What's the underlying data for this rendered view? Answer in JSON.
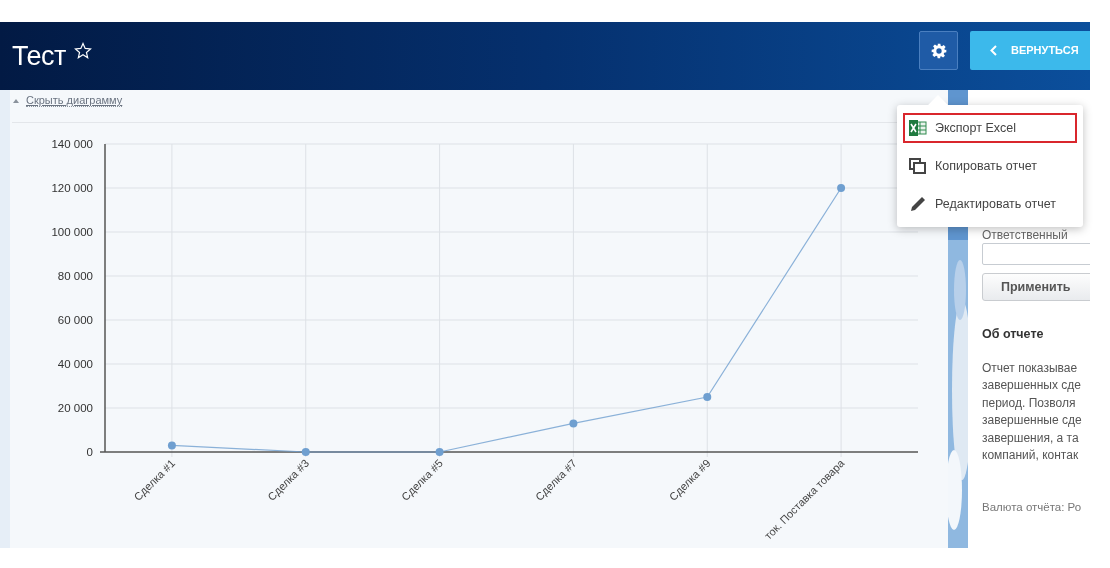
{
  "header": {
    "title": "Тест",
    "favorite": false,
    "back_button": "ВЕРНУТЬСЯ"
  },
  "menu": {
    "items": [
      {
        "kind": "excel",
        "label": "Экспорт Excel",
        "highlighted": true
      },
      {
        "kind": "copy",
        "label": "Копировать отчет",
        "highlighted": false
      },
      {
        "kind": "edit",
        "label": "Редактировать отчет",
        "highlighted": false
      }
    ]
  },
  "chart_toggle": "Скрыть диаграмму",
  "chart": {
    "chart_data": {
      "type": "line",
      "categories": [
        "Сделка #1",
        "Сделка #3",
        "Сделка #5",
        "Сделка #7",
        "Сделка #9",
        "ток. Поставка товара"
      ],
      "grid": true,
      "series": [
        {
          "color": "#6f9fd0",
          "marker": true,
          "values": [
            3000,
            0,
            0,
            13000,
            25000,
            120000
          ]
        }
      ],
      "ylim": [
        0,
        140000
      ],
      "yticks": [
        {
          "value": 0,
          "label": "0"
        },
        {
          "value": 20000,
          "label": "20 000"
        },
        {
          "value": 40000,
          "label": "40 000"
        },
        {
          "value": 60000,
          "label": "60 000"
        },
        {
          "value": 80000,
          "label": "80 000"
        },
        {
          "value": 100000,
          "label": "100 000"
        },
        {
          "value": 120000,
          "label": "120 000"
        },
        {
          "value": 140000,
          "label": "140 000"
        }
      ]
    }
  },
  "filter": {
    "responsible_label": "Ответственный",
    "apply_button": "Применить"
  },
  "about": {
    "title": "Об отчете",
    "lines": [
      "Отчет показывае",
      "завершенных сде",
      "период. Позволя",
      "завершенные сде",
      "завершения, а та",
      "компаний, контак"
    ],
    "currency": "Валюта отчёта: Ро"
  }
}
